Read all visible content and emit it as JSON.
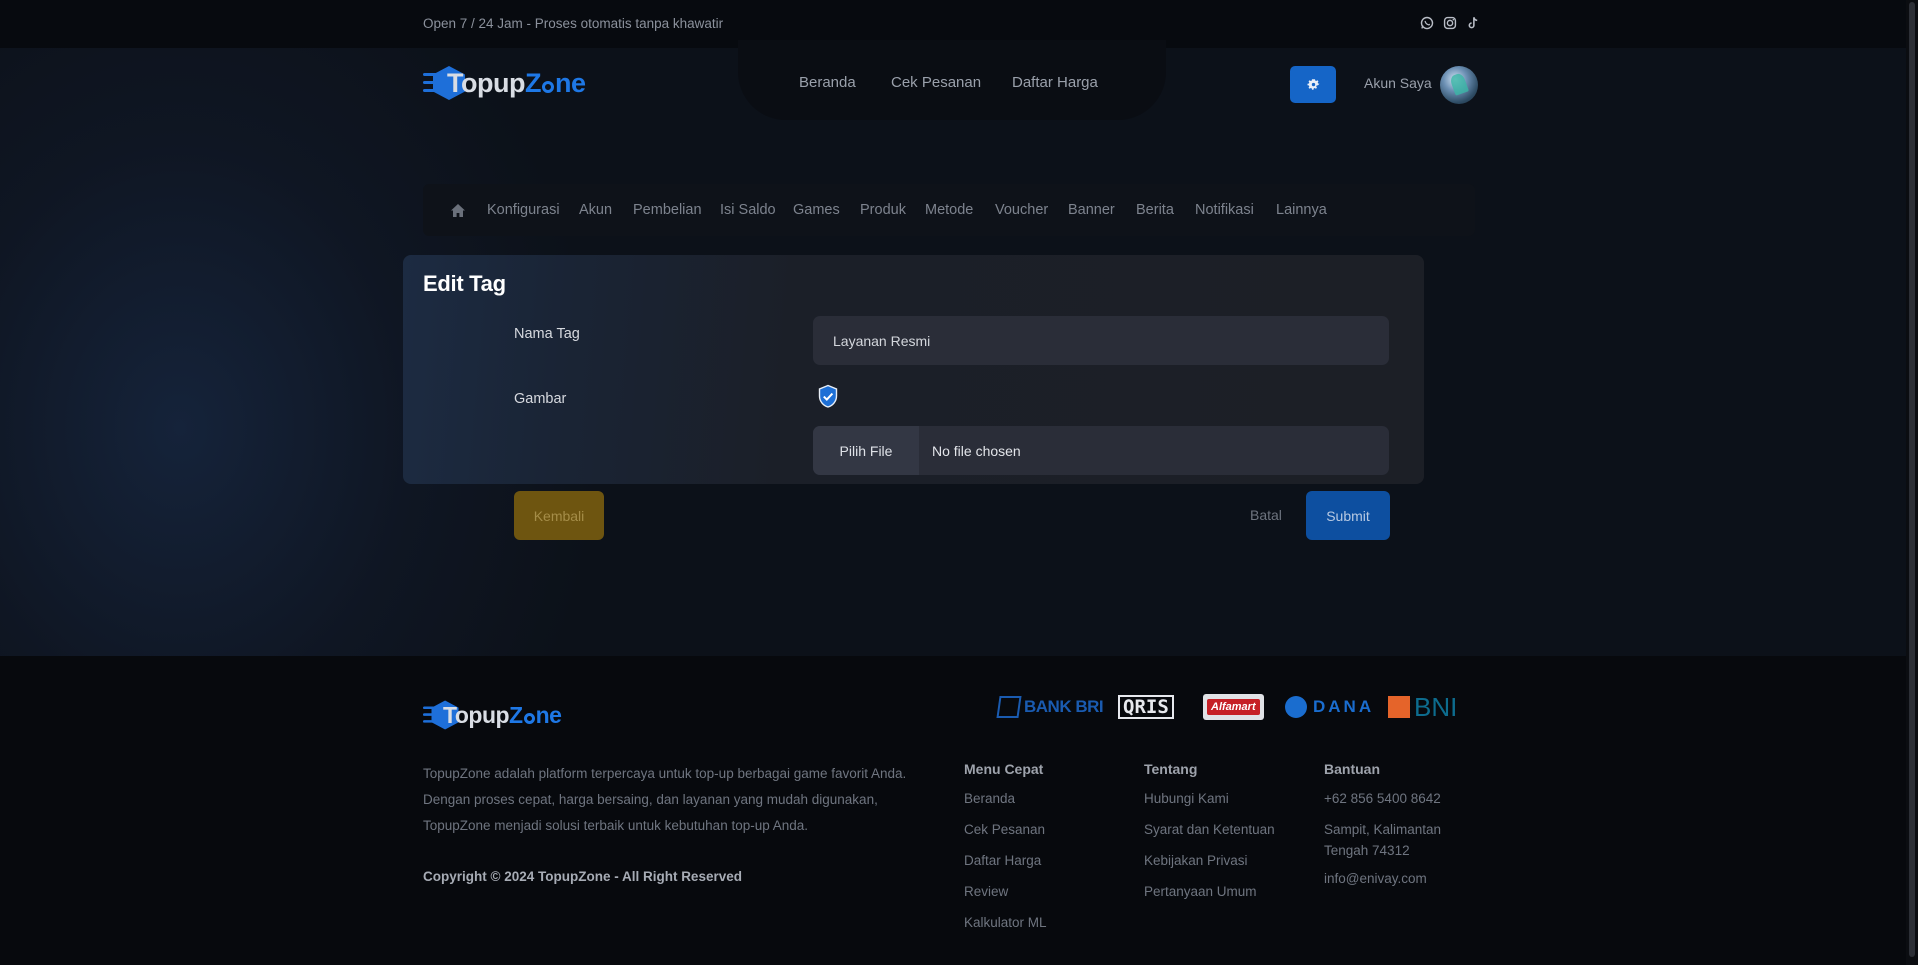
{
  "topbar": {
    "open_text": "Open 7 / 24 Jam - Proses otomatis tanpa khawatir",
    "socials": [
      "whatsapp-icon",
      "instagram-icon",
      "tiktok-icon"
    ]
  },
  "brand": {
    "part1": "Topup",
    "part2_a": "Z",
    "part2_b": "ne",
    "name": "TopupZone"
  },
  "nav": {
    "home": "Beranda",
    "check_order": "Cek Pesanan",
    "price_list": "Daftar Harga"
  },
  "account": {
    "label": "Akun Saya"
  },
  "admin_menu": {
    "items": [
      "Konfigurasi",
      "Akun",
      "Pembelian",
      "Isi Saldo",
      "Games",
      "Produk",
      "Metode",
      "Voucher",
      "Banner",
      "Berita",
      "Notifikasi",
      "Lainnya"
    ]
  },
  "form": {
    "title": "Edit Tag",
    "name_label": "Nama Tag",
    "name_value": "Layanan Resmi",
    "image_label": "Gambar",
    "file_button": "Pilih File",
    "file_status": "No file chosen"
  },
  "actions": {
    "back": "Kembali",
    "cancel": "Batal",
    "submit": "Submit"
  },
  "footer": {
    "description": "TopupZone adalah platform terpercaya untuk top-up berbagai game favorit Anda. Dengan proses cepat, harga bersaing, dan layanan yang mudah digunakan, TopupZone menjadi solusi terbaik untuk kebutuhan top-up Anda.",
    "copyright": "Copyright © 2024 TopupZone - All Right Reserved",
    "payments": [
      "BANK BRI",
      "QRIS",
      "Alfamart",
      "DANA",
      "BNI"
    ],
    "menu": {
      "title": "Menu Cepat",
      "links": [
        "Beranda",
        "Cek Pesanan",
        "Daftar Harga",
        "Review",
        "Kalkulator ML"
      ]
    },
    "about": {
      "title": "Tentang",
      "links": [
        "Hubungi Kami",
        "Syarat dan Ketentuan",
        "Kebijakan Privasi",
        "Pertanyaan Umum"
      ]
    },
    "help": {
      "title": "Bantuan",
      "phone": "+62 856 5400 8642",
      "address": "Sampit, Kalimantan Tengah 74312",
      "email": "info@enivay.com"
    }
  },
  "colors": {
    "accent": "#1565c7",
    "back_button": "#6e5510",
    "background": "#0c1017"
  }
}
